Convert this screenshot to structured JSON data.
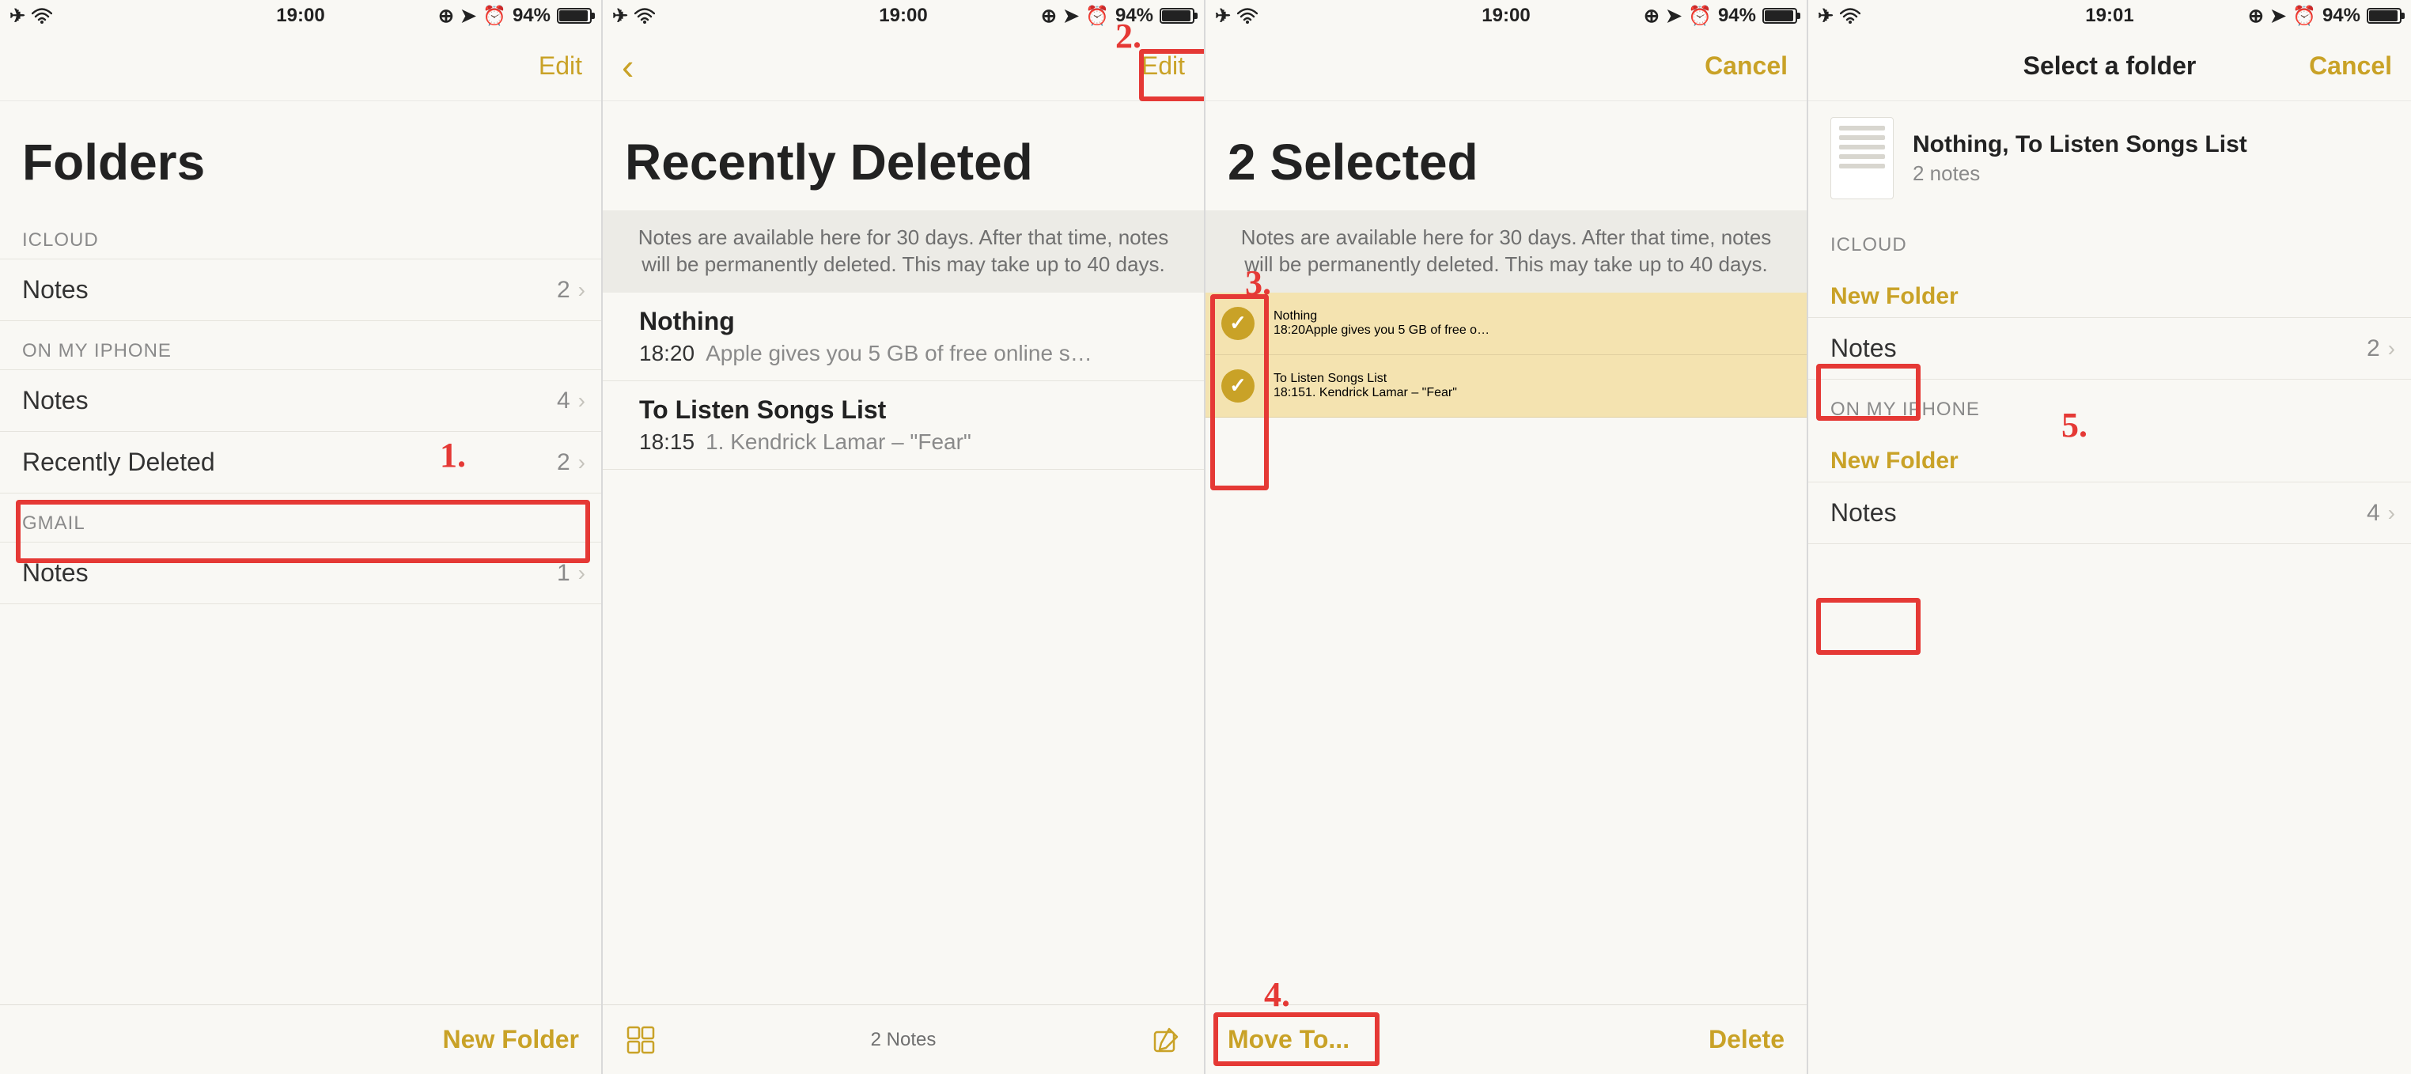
{
  "status": {
    "time_a": "19:00",
    "time_b": "19:01",
    "battery": "94%"
  },
  "annotations": {
    "s1": "1.",
    "s2": "2.",
    "s3": "3.",
    "s4": "4.",
    "s5": "5."
  },
  "pane1": {
    "edit": "Edit",
    "title": "Folders",
    "icloud": "ICLOUD",
    "icloud_notes": {
      "label": "Notes",
      "count": "2"
    },
    "onmyiphone": "ON MY IPHONE",
    "omp_notes": {
      "label": "Notes",
      "count": "4"
    },
    "omp_rd": {
      "label": "Recently Deleted",
      "count": "2"
    },
    "gmail": "GMAIL",
    "gmail_notes": {
      "label": "Notes",
      "count": "1"
    },
    "new_folder": "New Folder"
  },
  "pane2": {
    "edit": "Edit",
    "title": "Recently Deleted",
    "banner": "Notes are available here for 30 days. After that time, notes will be permanently deleted. This may take up to 40 days.",
    "notes": [
      {
        "title": "Nothing",
        "time": "18:20",
        "preview": "Apple gives you 5 GB of free online s…"
      },
      {
        "title": "To Listen Songs List",
        "time": "18:15",
        "preview": "1. Kendrick Lamar – \"Fear\""
      }
    ],
    "footer_count": "2 Notes"
  },
  "pane3": {
    "cancel": "Cancel",
    "title": "2 Selected",
    "banner": "Notes are available here for 30 days. After that time, notes will be permanently deleted. This may take up to 40 days.",
    "notes": [
      {
        "title": "Nothing",
        "time": "18:20",
        "preview": "Apple gives you 5 GB of free o…"
      },
      {
        "title": "To Listen Songs List",
        "time": "18:15",
        "preview": "1. Kendrick Lamar – \"Fear\""
      }
    ],
    "move_to": "Move To...",
    "delete": "Delete"
  },
  "pane4": {
    "cancel": "Cancel",
    "nav_title": "Select a folder",
    "thumb_title": "Nothing, To Listen Songs List",
    "thumb_sub": "2 notes",
    "icloud": "ICLOUD",
    "new_folder": "New Folder",
    "icloud_notes": {
      "label": "Notes",
      "count": "2"
    },
    "onmyiphone": "ON MY IPHONE",
    "omp_notes": {
      "label": "Notes",
      "count": "4"
    }
  }
}
